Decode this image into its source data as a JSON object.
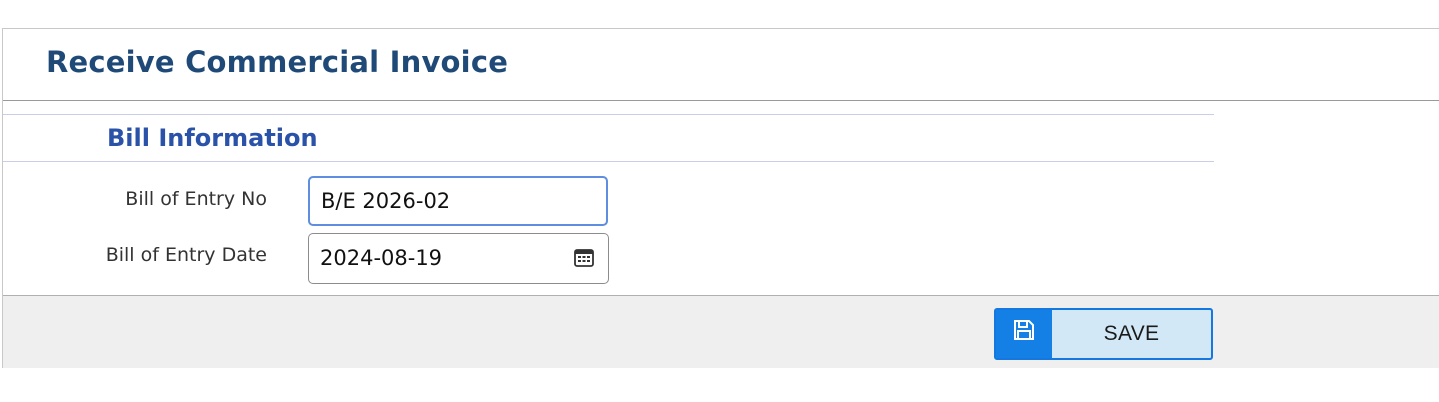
{
  "header": {
    "title": "Receive Commercial Invoice"
  },
  "section": {
    "title": "Bill Information"
  },
  "fields": {
    "bill_of_entry_no": {
      "label": "Bill of Entry No",
      "value": "B/E 2026-02"
    },
    "bill_of_entry_date": {
      "label": "Bill of Entry Date",
      "value": "2024-08-19",
      "icon": "calendar-icon"
    }
  },
  "footer": {
    "save_label": "SAVE",
    "save_icon": "floppy-disk-icon"
  },
  "colors": {
    "title": "#1f4a78",
    "section_title": "#2a52a8",
    "save_accent": "#1480e6",
    "save_bg": "#d2e8f6",
    "focus_border": "#5f8ee0"
  }
}
